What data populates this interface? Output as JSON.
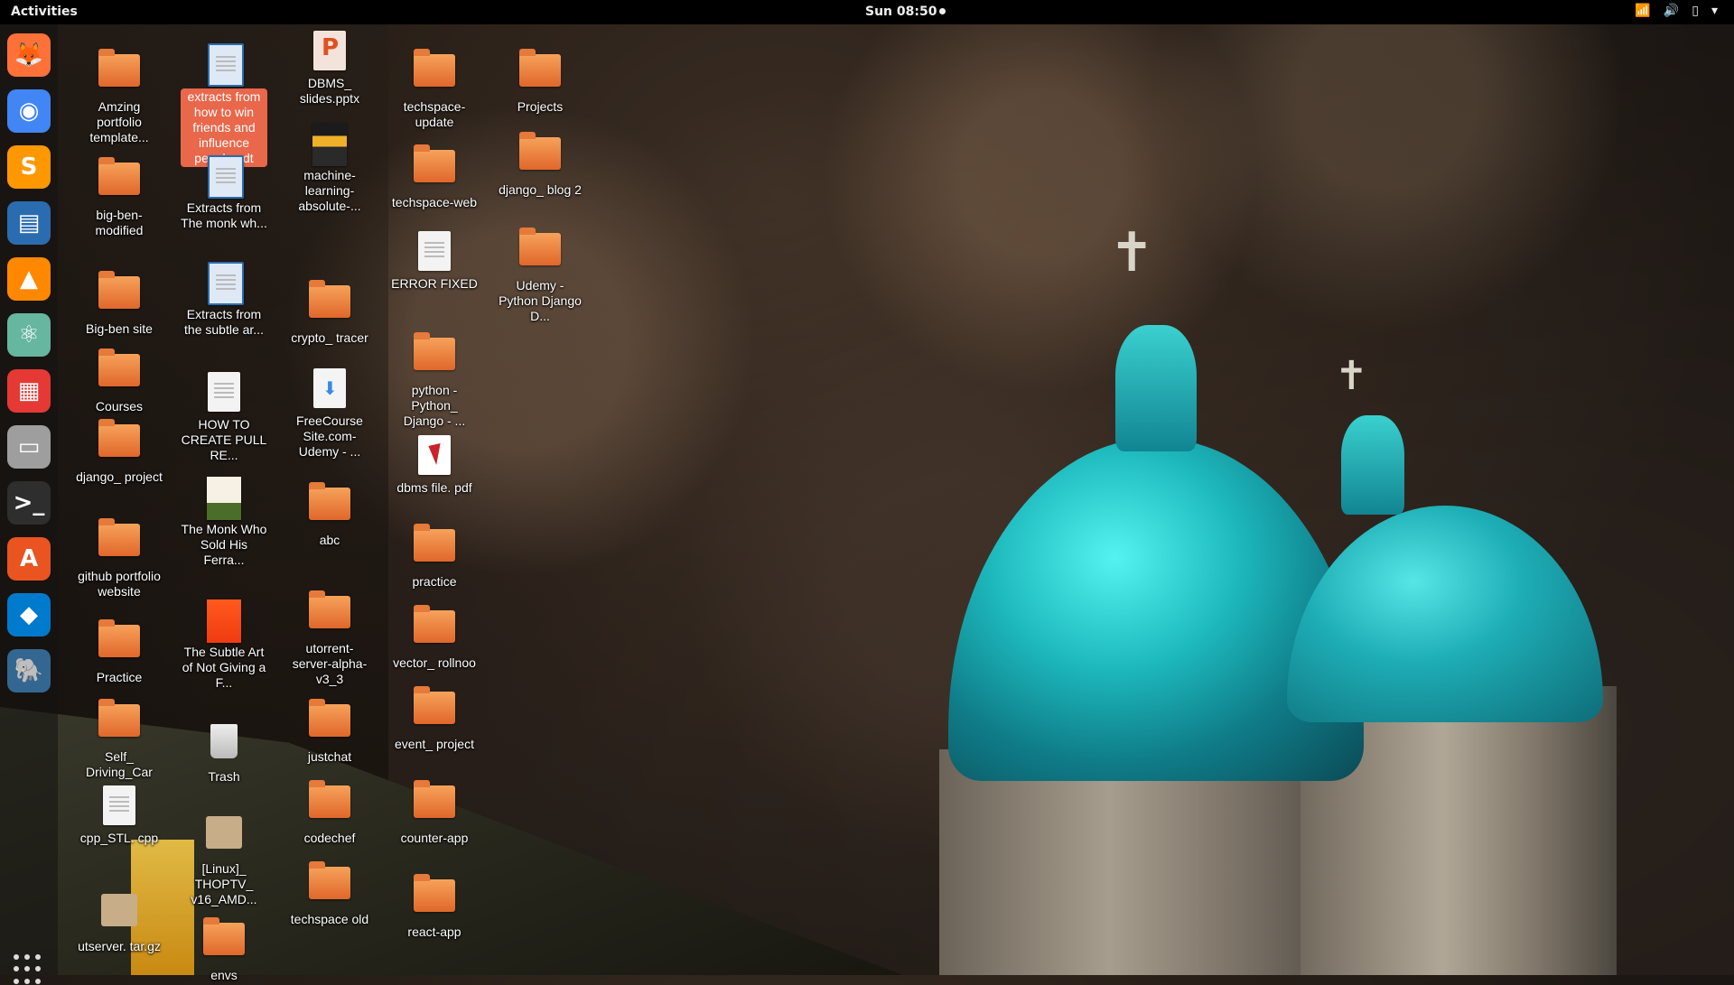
{
  "topbar": {
    "activities": "Activities",
    "clock": "Sun 08:50"
  },
  "dock": [
    {
      "name": "firefox-icon",
      "color": "#ff7139"
    },
    {
      "name": "chrome-icon",
      "color": "#4285f4"
    },
    {
      "name": "sublime-text-icon",
      "color": "#ff9800"
    },
    {
      "name": "libreoffice-writer-icon",
      "color": "#2b6cb0"
    },
    {
      "name": "vlc-icon",
      "color": "#ff8800"
    },
    {
      "name": "atom-icon",
      "color": "#66b6a0"
    },
    {
      "name": "colorful-app-icon",
      "color": "#e53935"
    },
    {
      "name": "files-icon",
      "color": "#9e9e9e"
    },
    {
      "name": "terminal-icon",
      "color": "#2e2e2e"
    },
    {
      "name": "software-store-icon",
      "color": "#e95420"
    },
    {
      "name": "vscode-icon",
      "color": "#007acc"
    },
    {
      "name": "postgresql-elephant-icon",
      "color": "#336791"
    }
  ],
  "desktop": {
    "col1": [
      {
        "label": "Amzing portfolio template...",
        "type": "folder"
      },
      {
        "label": "big-ben-modified",
        "type": "folder"
      },
      {
        "label": "Big-ben site",
        "type": "folder"
      },
      {
        "label": "Courses",
        "type": "folder"
      },
      {
        "label": "django_ project",
        "type": "folder"
      },
      {
        "label": "github portfolio website",
        "type": "folder"
      },
      {
        "label": "Practice",
        "type": "folder"
      },
      {
        "label": "Self_ Driving_Car",
        "type": "folder"
      },
      {
        "label": "cpp_STL. cpp",
        "type": "doc"
      },
      {
        "label": "utserver. tar.gz",
        "type": "archive"
      }
    ],
    "col2": [
      {
        "label": "extracts from how to win friends and influence people.odt",
        "type": "writer",
        "selected": true
      },
      {
        "label": "Extracts from The monk wh...",
        "type": "writer"
      },
      {
        "label": "Extracts from the subtle ar...",
        "type": "writer"
      },
      {
        "label": "HOW TO CREATE PULL RE...",
        "type": "doc"
      },
      {
        "label": "The Monk Who Sold His Ferra...",
        "type": "book-monk"
      },
      {
        "label": "The Subtle Art of Not Giving a F...",
        "type": "book-subtle"
      },
      {
        "label": "Trash",
        "type": "trash"
      },
      {
        "label": "[Linux]_ THOPTV_ v16_AMD...",
        "type": "archive"
      },
      {
        "label": "envs",
        "type": "folder"
      }
    ],
    "col3": [
      {
        "label": "DBMS_ slides.pptx",
        "type": "ppt"
      },
      {
        "label": "machine-learning-absolute-...",
        "type": "book-ml"
      },
      {
        "label": "crypto_ tracer",
        "type": "folder"
      },
      {
        "label": "FreeCourse Site.com- Udemy - ...",
        "type": "download"
      },
      {
        "label": "abc",
        "type": "folder"
      },
      {
        "label": "utorrent-server-alpha-v3_3",
        "type": "folder"
      },
      {
        "label": "justchat",
        "type": "folder"
      },
      {
        "label": "codechef",
        "type": "folder"
      },
      {
        "label": "techspace old",
        "type": "folder"
      }
    ],
    "col4": [
      {
        "label": "techspace-update",
        "type": "folder"
      },
      {
        "label": "techspace-web",
        "type": "folder"
      },
      {
        "label": "ERROR FIXED",
        "type": "doc"
      },
      {
        "label": "python - Python_ Django - ...",
        "type": "folder"
      },
      {
        "label": "dbms file. pdf",
        "type": "pdf"
      },
      {
        "label": "practice",
        "type": "folder"
      },
      {
        "label": "vector_ rollnoo",
        "type": "folder"
      },
      {
        "label": "event_ project",
        "type": "folder"
      },
      {
        "label": "counter-app",
        "type": "folder"
      },
      {
        "label": "react-app",
        "type": "folder"
      }
    ],
    "col5": [
      {
        "label": "Projects",
        "type": "folder"
      },
      {
        "label": "django_ blog 2",
        "type": "folder"
      },
      {
        "label": "Udemy - Python Django D...",
        "type": "folder"
      }
    ]
  }
}
